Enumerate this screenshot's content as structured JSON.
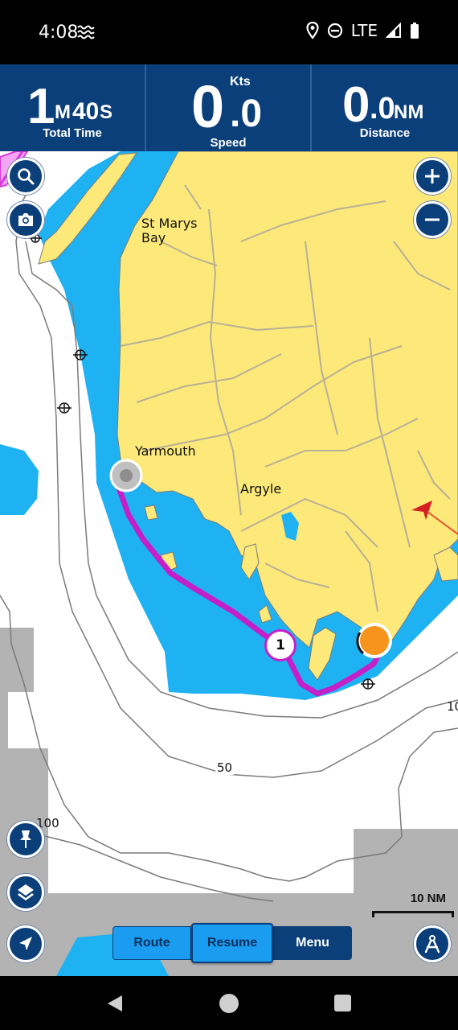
{
  "status": {
    "time": "4:08",
    "network": "LTE"
  },
  "dashboard": {
    "total_time": {
      "value_big": "1",
      "value_unit1": "M",
      "value_mid": "40",
      "value_unit2": "S",
      "label": "Total Time"
    },
    "speed": {
      "value_big": "0",
      "value_dec": ".0",
      "unit": "Kts",
      "label": "Speed"
    },
    "distance": {
      "value_big": "0",
      "value_dec": ".0",
      "unit": "NM",
      "label": "Distance"
    }
  },
  "map": {
    "places": {
      "st_marys_bay": "St Marys\nBay",
      "yarmouth": "Yarmouth",
      "argyle": "Argyle"
    },
    "depths": {
      "d50": "50",
      "d100": "100",
      "d10_partial": "10"
    },
    "waypoint_number": "1",
    "scale": "10 NM"
  },
  "controls": {
    "route_label": "Route",
    "resume_label": "Resume",
    "menu_label": "Menu"
  },
  "colors": {
    "land": "#fce97a",
    "shallow_water": "#1fb2f3",
    "route": "#c41fc9",
    "dashboard": "#0b3f7a",
    "restricted_area": "#b3b3b3"
  }
}
